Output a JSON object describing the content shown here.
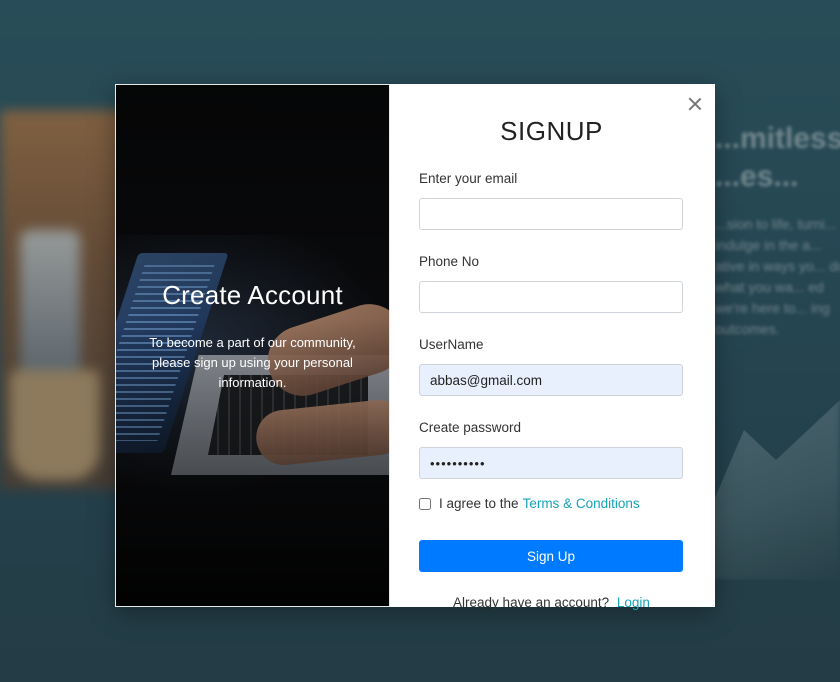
{
  "modal": {
    "title": "SIGNUP",
    "left_panel": {
      "title": "Create Account",
      "description": "To become a part of our community, please sign up using your personal information."
    },
    "fields": {
      "email": {
        "label": "Enter your email",
        "value": ""
      },
      "phone": {
        "label": "Phone No",
        "value": ""
      },
      "username": {
        "label": "UserName",
        "value": "abbas@gmail.com"
      },
      "password": {
        "label": "Create password",
        "value": "••••••••••"
      }
    },
    "agree": {
      "text": "I agree to the",
      "link_text": "Terms & Conditions",
      "checked": false
    },
    "signup_button_label": "Sign Up",
    "login_prompt": {
      "text": "Already have an account?",
      "link_text": "Login"
    },
    "close_icon": "close-icon"
  },
  "background": {
    "heading": "...mitless ...es...",
    "paragraph": "...sion to life, turni... indulge in the a... ative in ways yo... do what you wa... ed we're here to... ing outcomes."
  },
  "colors": {
    "primary": "#007bff",
    "link": "#17a2b8",
    "autofill": "#e8f0fe"
  }
}
